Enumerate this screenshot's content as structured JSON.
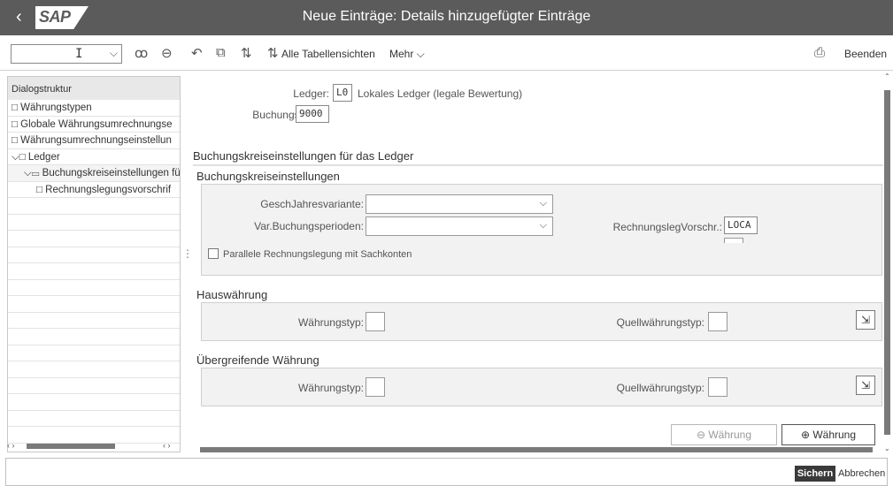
{
  "window": {
    "title": "Neue Einträge: Details hinzugefügter Einträge",
    "logo": "SAP",
    "back_icon": "‹"
  },
  "toolbar": {
    "command_field_value": "",
    "command_caret": "I",
    "dropdown_icon": "⌵",
    "icons": [
      "glasses-icon",
      "minus-circle-icon",
      "undo-icon",
      "copy-icon",
      "transport-icon"
    ],
    "all_table_views_label": "Alle Tabellensichten",
    "more_label": "Mehr ⌵",
    "print_icon": "⎙",
    "exit_label": "Beenden"
  },
  "dialog_structure": {
    "header": "Dialogstruktur",
    "items": [
      {
        "label": "Währungstypen",
        "indent": 0,
        "prefix": "□ "
      },
      {
        "label": "Globale Währungsumrechnungse",
        "indent": 0,
        "prefix": "□ "
      },
      {
        "label": "Währungsumrechnungseinstellun",
        "indent": 0,
        "prefix": "□ "
      },
      {
        "label": "Ledger",
        "indent": 0,
        "prefix": "⌵□ "
      },
      {
        "label": "Buchungskreiseinstellungen fü",
        "indent": 1,
        "prefix": "⌵▭ "
      },
      {
        "label": "Rechnungslegungsvorschrif",
        "indent": 2,
        "prefix": "□ "
      }
    ],
    "empty_rows": 15
  },
  "form": {
    "ledger_label": "Ledger:",
    "ledger_value": "L0",
    "ledger_desc": "Lokales Ledger (legale Bewertung)",
    "company_code_label": "Buchungskreis:*",
    "company_code_value": "9000",
    "section_title": "Buchungskreiseinstellungen für das Ledger",
    "group1_title": "Buchungskreiseinstellungen",
    "fiscal_year_variant_label": "GeschJahresvariante:",
    "fiscal_year_variant_value": "",
    "posting_period_variant_label": "Var.Buchungsperioden:",
    "posting_period_variant_value": "",
    "accounting_principle_label": "RechnungslegVorschr.:",
    "accounting_principle_value": "LOCA",
    "parallel_accounting_label": "Parallele Rechnungslegung mit Sachkonten",
    "parallel_accounting_checked": false,
    "local_currency_title": "Hauswährung",
    "currency_type_label": "Währungstyp:",
    "source_currency_type_label": "Quellwährungstyp:",
    "global_currency_title": "Übergreifende Währung",
    "currency_type_label_2": "Währungstyp:",
    "source_currency_type_label_2": "Quellwährungstyp:",
    "remove_currency_label": "⊖ Währung",
    "add_currency_label": "⊕ Währung",
    "value_help_icon": "⇲"
  },
  "footer": {
    "save_label": "Sichern",
    "cancel_label": "Abbrechen"
  },
  "colors": {
    "title_bar": "#5b5b5b",
    "save_button": "#3a3a3a",
    "group_bg": "#f2f2f2"
  }
}
